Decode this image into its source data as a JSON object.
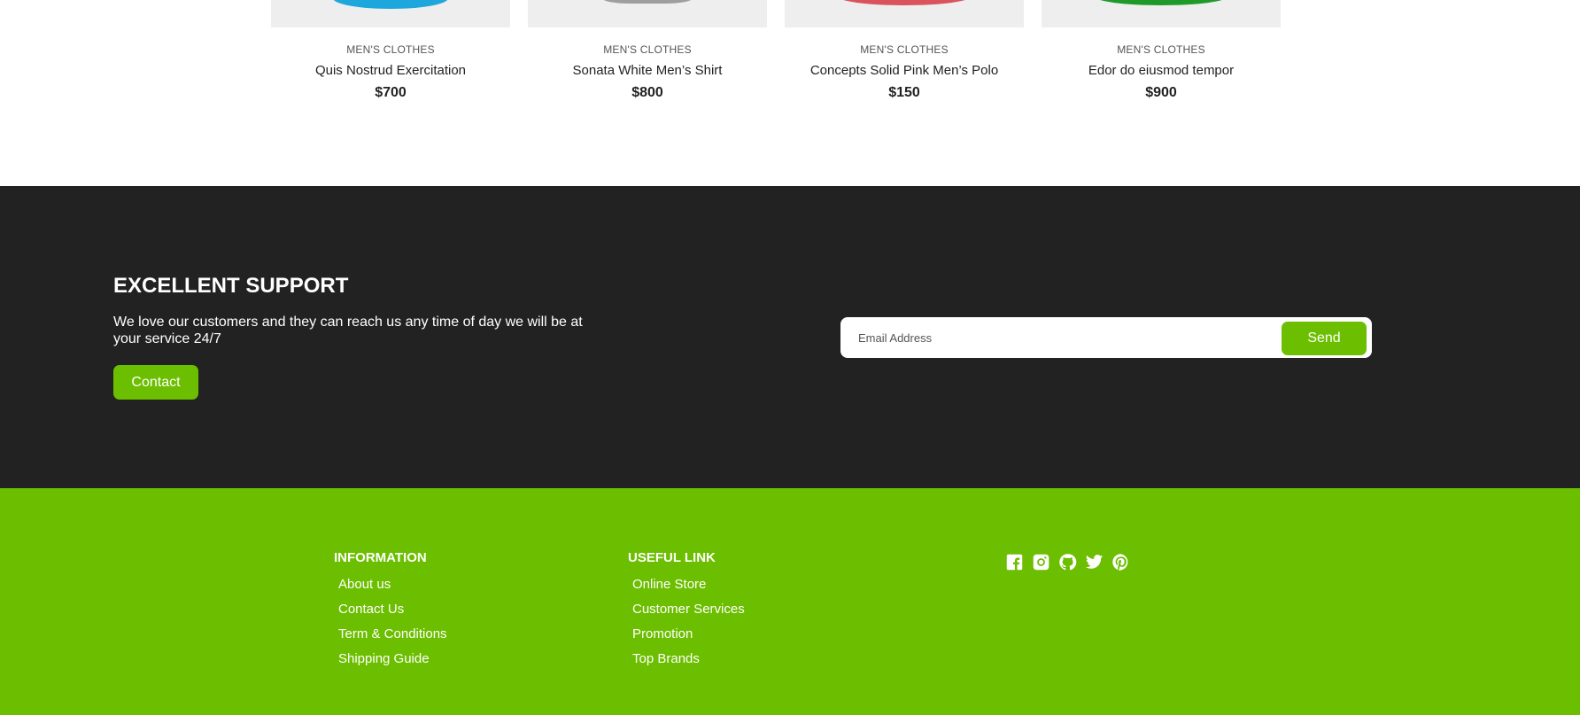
{
  "products": [
    {
      "category": "MEN'S CLOTHES",
      "name": "Quis Nostrud Exercitation",
      "price": "$700",
      "color": "#1ea7dc"
    },
    {
      "category": "MEN'S CLOTHES",
      "name": "Sonata White Men’s Shirt",
      "price": "$800",
      "color": "#8a8a8a"
    },
    {
      "category": "MEN'S CLOTHES",
      "name": "Concepts Solid Pink Men’s Polo",
      "price": "$150",
      "color": "#d9545c"
    },
    {
      "category": "MEN'S CLOTHES",
      "name": "Edor do eiusmod tempor",
      "price": "$900",
      "color": "#1f9a2a"
    }
  ],
  "support": {
    "title": "EXCELLENT SUPPORT",
    "description": "We love our customers and they can reach us any time of day we will be at your service 24/7",
    "contact_label": "Contact",
    "email_placeholder": "Email Address",
    "send_label": "Send"
  },
  "footer": {
    "information": {
      "heading": "INFORMATION",
      "links": [
        "About us",
        "Contact Us",
        "Term & Conditions",
        "Shipping Guide"
      ]
    },
    "useful": {
      "heading": "USEFUL LINK",
      "links": [
        "Online Store",
        "Customer Services",
        "Promotion",
        "Top Brands"
      ]
    },
    "social_icons": [
      "facebook-icon",
      "instagram-icon",
      "github-icon",
      "twitter-icon",
      "pinterest-icon"
    ]
  },
  "colors": {
    "accent": "#6cbe00",
    "dark": "#222222"
  }
}
